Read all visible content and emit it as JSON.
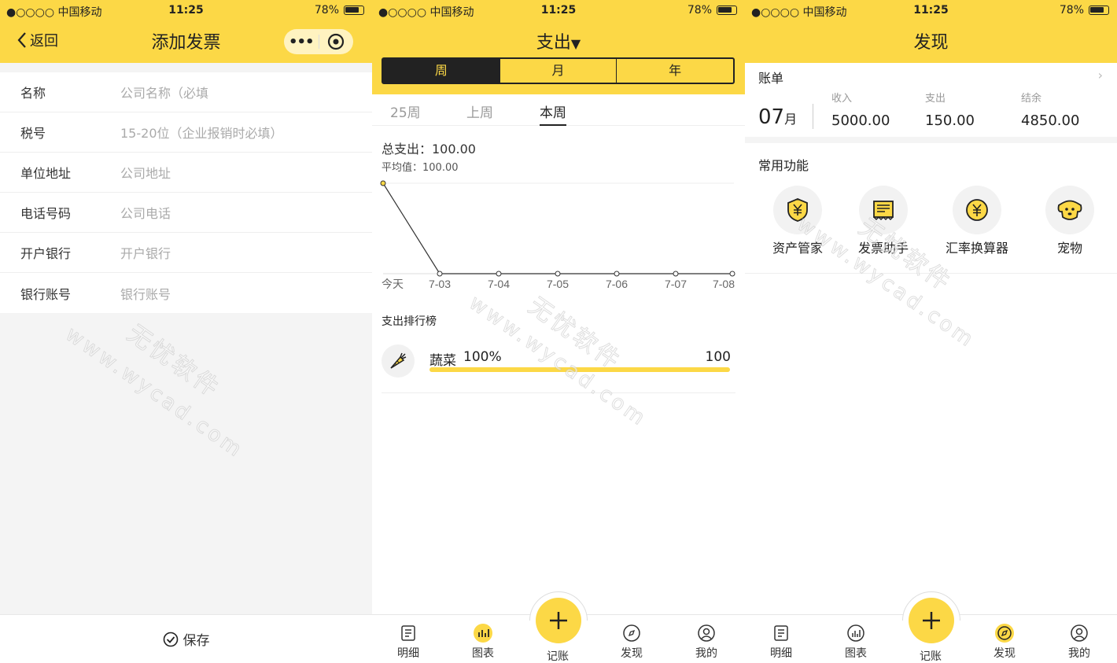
{
  "status": {
    "carrier": "●○○○○ 中国移动",
    "time": "11:25",
    "battery": "78%"
  },
  "panel1": {
    "back_label": "返回",
    "title": "添加发票",
    "menu_dots": "•••",
    "fields": [
      {
        "label": "名称",
        "placeholder": "公司名称（必填"
      },
      {
        "label": "税号",
        "placeholder": "15-20位（企业报销时必填）"
      },
      {
        "label": "单位地址",
        "placeholder": "公司地址"
      },
      {
        "label": "电话号码",
        "placeholder": "公司电话"
      },
      {
        "label": "开户银行",
        "placeholder": "开户银行"
      },
      {
        "label": "银行账号",
        "placeholder": "银行账号"
      }
    ],
    "save_label": "保存"
  },
  "panel2": {
    "title": "支出",
    "title_caret": "▼",
    "segments": [
      "周",
      "月",
      "年"
    ],
    "active_segment": 0,
    "weeks": [
      "25周",
      "上周",
      "本周"
    ],
    "active_week": 2,
    "total_label": "总支出：100.00",
    "avg_label": "平均值：100.00",
    "ranking_title": "支出排行榜",
    "ranking": [
      {
        "name": "蔬菜",
        "percent": "100%",
        "value": "100",
        "fill": 1.0
      }
    ]
  },
  "chart_data": {
    "type": "line",
    "categories": [
      "今天",
      "7-03",
      "7-04",
      "7-05",
      "7-06",
      "7-07",
      "7-08"
    ],
    "values": [
      100,
      0,
      0,
      0,
      0,
      0,
      0
    ],
    "title": "",
    "xlabel": "",
    "ylabel": "",
    "ylim": [
      0,
      100
    ],
    "color": "#fcd846"
  },
  "panel3": {
    "title": "发现",
    "bill_title": "账单",
    "month_num": "07",
    "month_unit": "月",
    "income_label": "收入",
    "income": "5000.00",
    "expense_label": "支出",
    "expense": "150.00",
    "balance_label": "结余",
    "balance": "4850.00",
    "func_title": "常用功能",
    "functions": [
      "资产管家",
      "发票助手",
      "汇率换算器",
      "宠物"
    ]
  },
  "tabbar": {
    "items": [
      "明细",
      "图表",
      "记账",
      "发现",
      "我的"
    ]
  },
  "watermark": {
    "cn": "无忧软件",
    "url": "www.wycad.com"
  },
  "colors": {
    "accent": "#fcd846",
    "dark": "#222222"
  }
}
